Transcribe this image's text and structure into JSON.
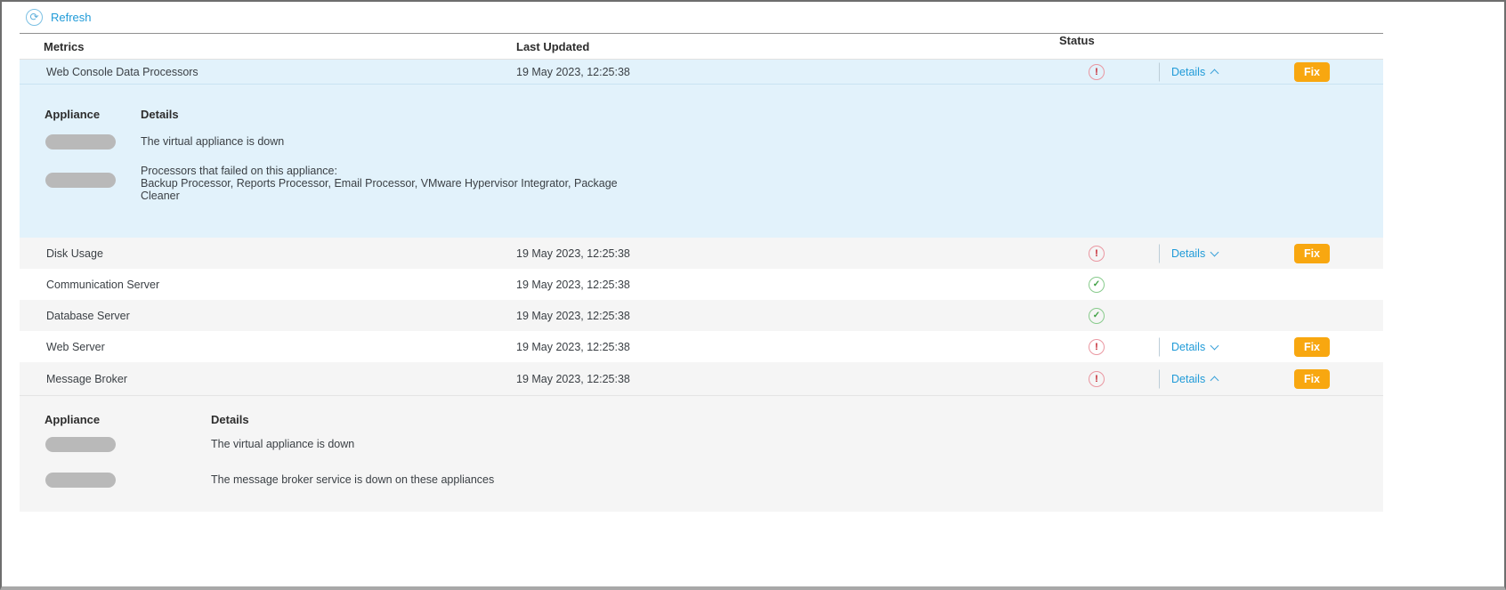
{
  "toolbar": {
    "refresh_label": "Refresh"
  },
  "table": {
    "headers": {
      "metrics": "Metrics",
      "last_updated": "Last Updated",
      "status": "Status"
    },
    "actions": {
      "details": "Details",
      "fix": "Fix"
    },
    "expansion_headers": {
      "appliance": "Appliance",
      "details": "Details"
    },
    "rows": [
      {
        "metric": "Web Console Data Processors",
        "last_updated": "19 May 2023, 12:25:38",
        "status": "error",
        "expanded": true,
        "expansion": {
          "rows": [
            {
              "appliance_redacted": true,
              "detail": "The virtual appliance is down"
            },
            {
              "appliance_redacted": true,
              "detail_intro": "Processors that failed on this appliance:",
              "detail_list": "Backup Processor, Reports Processor, Email Processor, VMware Hypervisor Integrator, Package Cleaner"
            }
          ]
        }
      },
      {
        "metric": "Disk Usage",
        "last_updated": "19 May 2023, 12:25:38",
        "status": "error",
        "expanded": false
      },
      {
        "metric": "Communication Server",
        "last_updated": "19 May 2023, 12:25:38",
        "status": "ok"
      },
      {
        "metric": "Database Server",
        "last_updated": "19 May 2023, 12:25:38",
        "status": "ok"
      },
      {
        "metric": "Web Server",
        "last_updated": "19 May 2023, 12:25:38",
        "status": "error",
        "expanded": false
      },
      {
        "metric": "Message Broker",
        "last_updated": "19 May 2023, 12:25:38",
        "status": "error",
        "expanded": true,
        "expansion": {
          "rows": [
            {
              "appliance_redacted": true,
              "detail": "The virtual appliance is down"
            },
            {
              "appliance_redacted": true,
              "detail": "The message broker service is down on these appliances"
            }
          ]
        }
      }
    ]
  },
  "icons": {
    "refresh": "refresh-circular-arrow",
    "error": "exclamation-circle",
    "ok": "check-circle"
  },
  "colors": {
    "accent_blue": "#209bd8",
    "fix_orange": "#f8a710",
    "error_red": "#c4242e",
    "success_green": "#3fa044",
    "highlight_blue": "#e2f2fb",
    "row_gray": "#f5f5f5"
  }
}
